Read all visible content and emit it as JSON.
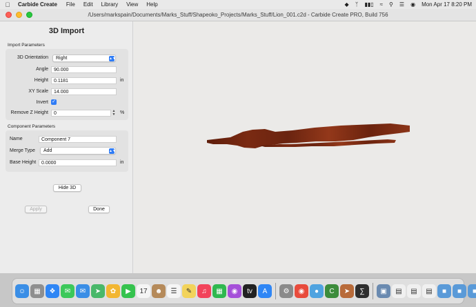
{
  "menubar": {
    "app_name": "Carbide Create",
    "menus": [
      "File",
      "Edit",
      "Library",
      "View",
      "Help"
    ],
    "clock": "Mon Apr 17  8:20 PM"
  },
  "window": {
    "title": "/Users/markspain/Documents/Marks_Stuff/Shapeoko_Projects/Marks_Stuff/Lion_001.c2d - Carbide Create PRO, Build 756"
  },
  "panel": {
    "title": "3D Import",
    "import_section": {
      "label": "Import Parameters",
      "orientation_label": "3D Orientation",
      "orientation_value": "Right",
      "angle_label": "Angle",
      "angle_value": "90.000",
      "height_label": "Height",
      "height_value": "0.1181",
      "height_unit": "in",
      "xy_scale_label": "XY Scale",
      "xy_scale_value": "14.000",
      "invert_label": "Invert",
      "invert_checked": true,
      "remove_z_label": "Remove Z Height",
      "remove_z_value": "0",
      "remove_z_unit": "%"
    },
    "component_section": {
      "label": "Component Parameters",
      "name_label": "Name",
      "name_value": "Component 7",
      "merge_label": "Merge Type",
      "merge_value": "Add",
      "base_height_label": "Base Height",
      "base_height_value": "0.0000",
      "base_height_unit": "in"
    },
    "hide_3d_label": "Hide 3D",
    "apply_label": "Apply",
    "done_label": "Done"
  },
  "model_color": "#7a2a12",
  "dock": {
    "icons": [
      "finder-icon",
      "launchpad-icon",
      "safari-icon",
      "messages-icon",
      "mail-icon",
      "maps-icon",
      "photos-icon",
      "facetime-icon",
      "calendar-icon",
      "contacts-icon",
      "reminders-icon",
      "notes-icon",
      "music-icon",
      "numbers-icon",
      "podcasts-icon",
      "tv-icon",
      "app-store-icon",
      "system-settings-icon",
      "chrome-icon",
      "finder-blue-icon",
      "carbide-create-icon",
      "carbide-copper-icon",
      "calculator-icon",
      "preview-icon",
      "document-icon",
      "document-icon",
      "document-icon",
      "folder-icon",
      "folder-icon",
      "folder-icon",
      "trash-icon"
    ]
  }
}
